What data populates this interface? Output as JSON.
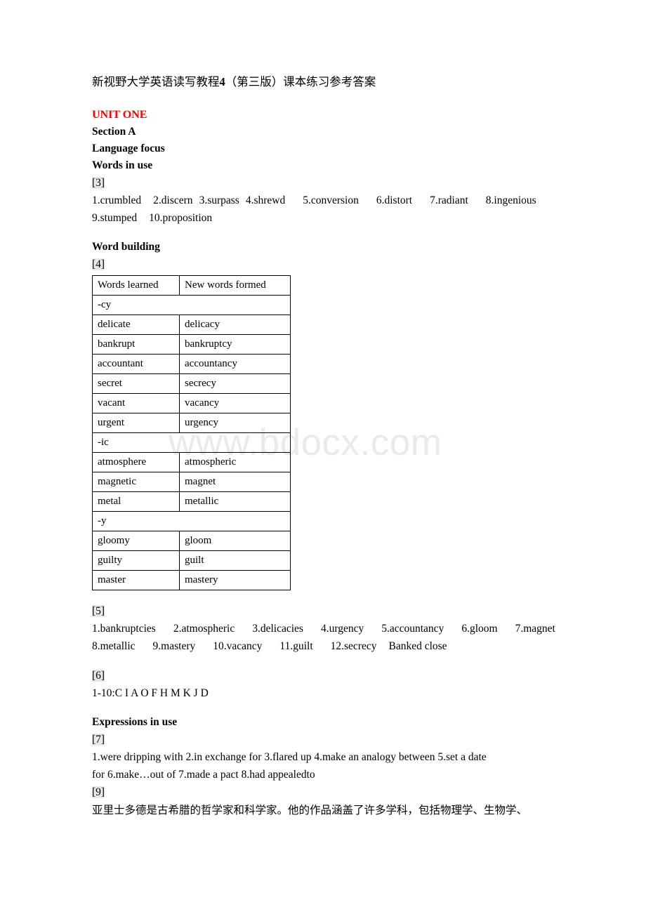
{
  "document": {
    "title_prefix": "新视野大学英语读写教程",
    "title_bold_num": "4",
    "title_suffix": "（第三版）课本练习参考答案",
    "watermark": "www.bdocx.com",
    "accent_color": "#ff0000"
  },
  "unit": {
    "heading": "UNIT ONE",
    "section": "Section A",
    "language_focus": "Language focus",
    "words_in_use": "Words in use",
    "word_building": "Word building",
    "expressions_in_use": "Expressions in use"
  },
  "exercise_3": {
    "label": "[3]",
    "answers_line1": [
      "1.crumbled",
      "2.discern",
      "3.surpass",
      "4.shrewd",
      "5.conversion",
      "6.distort",
      "7.radiant",
      "8.ingenious"
    ],
    "answers_line2": [
      "9.stumped",
      "10.proposition"
    ]
  },
  "exercise_4": {
    "label": "[4]",
    "table": {
      "headers": [
        "Words learned",
        "New words formed"
      ],
      "groups": [
        {
          "suffix": "-cy",
          "rows": [
            [
              "delicate",
              "delicacy"
            ],
            [
              "bankrupt",
              "bankruptcy"
            ],
            [
              "accountant",
              "accountancy"
            ],
            [
              "secret",
              "secrecy"
            ],
            [
              "vacant",
              "vacancy"
            ],
            [
              "urgent",
              "urgency"
            ]
          ]
        },
        {
          "suffix": "-ic",
          "rows": [
            [
              "atmosphere",
              "atmospheric"
            ],
            [
              "magnetic",
              "magnet"
            ],
            [
              "metal",
              "metallic"
            ]
          ]
        },
        {
          "suffix": "-y",
          "rows": [
            [
              "gloomy",
              "gloom"
            ],
            [
              "guilty",
              "guilt"
            ],
            [
              "master",
              "mastery"
            ]
          ]
        }
      ]
    }
  },
  "exercise_5": {
    "label": "[5]",
    "answers_line1": [
      "1.bankruptcies",
      "2.atmospheric",
      "3.delicacies",
      "4.urgency",
      "5.accountancy",
      "6.gloom",
      "7.magnet"
    ],
    "answers_line2": [
      "8.metallic",
      "9.mastery",
      "10.vacancy",
      "11.guilt",
      "12.secrecy",
      "Banked close"
    ]
  },
  "exercise_6": {
    "label": "[6]",
    "answer": "1-10:C I A O F H M K J D"
  },
  "exercise_7": {
    "label": "[7]",
    "line1": "1.were dripping with    2.in exchange for    3.flared up  4.make an analogy between  5.set a date",
    "line2": "for    6.make…out of 7.made a pact 8.had appealedto"
  },
  "exercise_9": {
    "label": "[9]",
    "translation": "亚里士多德是古希腊的哲学家和科学家。他的作品涵盖了许多学科，包括物理学、生物学、"
  }
}
